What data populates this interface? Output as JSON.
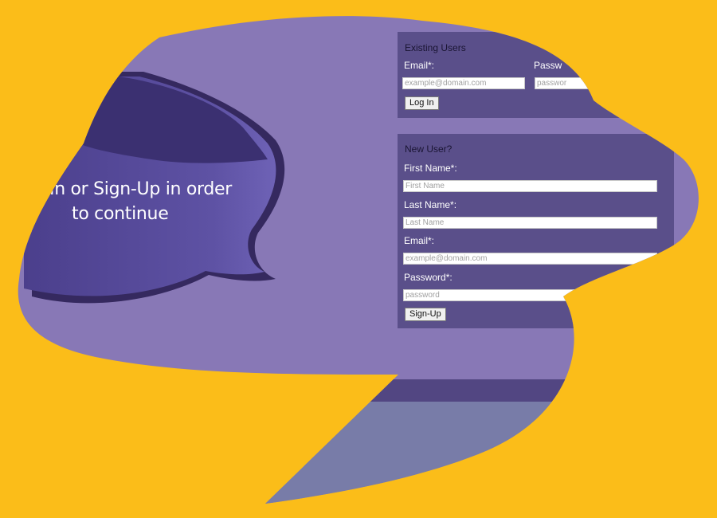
{
  "prompt": {
    "line1": "In or Sign-Up in order",
    "line2": "to continue"
  },
  "login": {
    "title": "Existing Users",
    "email_label": "Email*:",
    "email_placeholder": "example@domain.com",
    "password_label": "Passw",
    "password_placeholder": "passwor",
    "button_label": "Log In"
  },
  "signup": {
    "title": "New User?",
    "first_name_label": "First Name*:",
    "first_name_placeholder": "First Name",
    "last_name_label": "Last Name*:",
    "last_name_placeholder": "Last Name",
    "email_label": "Email*:",
    "email_placeholder": "example@domain.com",
    "password_label": "Password*:",
    "password_placeholder": "password",
    "button_label": "Sign-Up"
  },
  "colors": {
    "background": "#fbbd19",
    "page": "#8878b6",
    "panel": "#5a4f8a",
    "bubble": "#5b4f9e"
  }
}
